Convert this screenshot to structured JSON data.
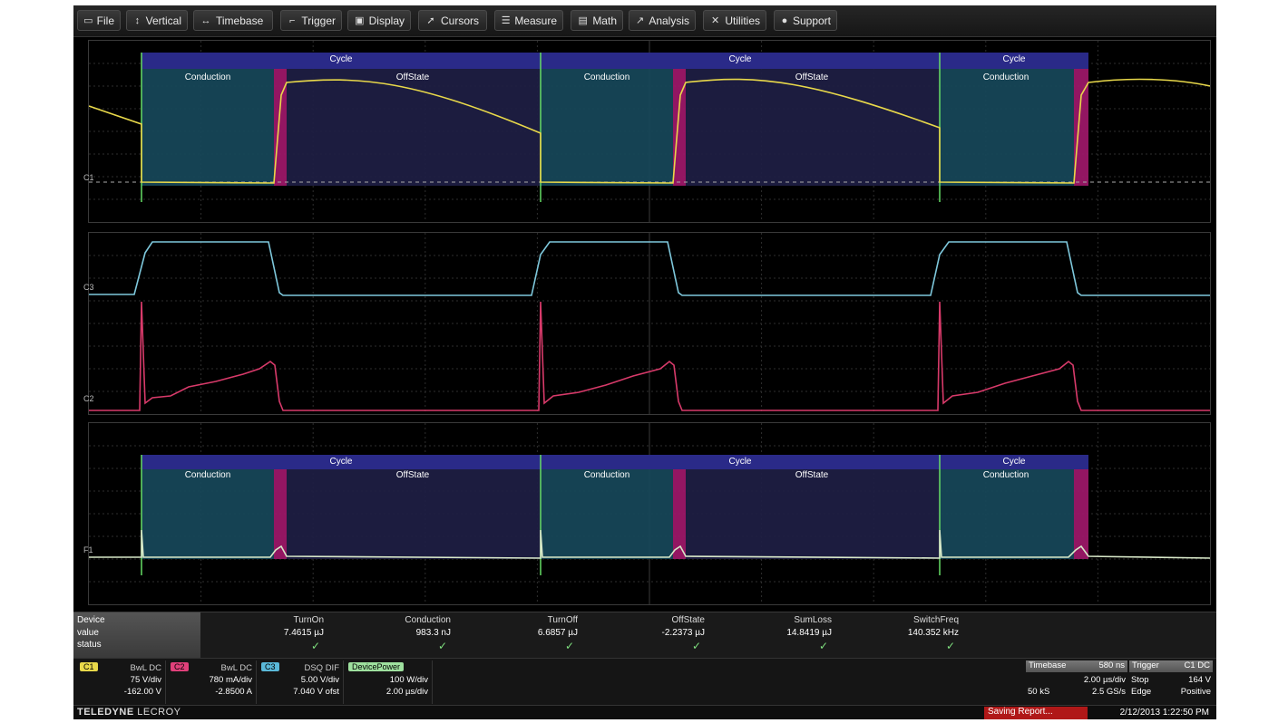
{
  "menu": [
    {
      "label": "File",
      "icon": "file-icon"
    },
    {
      "label": "Vertical",
      "icon": "vertical-icon"
    },
    {
      "label": "Timebase",
      "icon": "timebase-icon"
    },
    {
      "label": "Trigger",
      "icon": "trigger-icon"
    },
    {
      "label": "Display",
      "icon": "display-icon"
    },
    {
      "label": "Cursors",
      "icon": "cursors-icon"
    },
    {
      "label": "Measure",
      "icon": "measure-icon"
    },
    {
      "label": "Math",
      "icon": "math-icon"
    },
    {
      "label": "Analysis",
      "icon": "analysis-icon"
    },
    {
      "label": "Utilities",
      "icon": "utilities-icon"
    },
    {
      "label": "Support",
      "icon": "support-icon"
    }
  ],
  "zones": {
    "cycle_label": "Cycle",
    "conduction_label": "Conduction",
    "offstate_label": "OffState"
  },
  "channel_markers": {
    "c1": "C1",
    "c2": "C2",
    "c3": "C3",
    "f1": "F1"
  },
  "measurements": {
    "row_labels": {
      "device": "Device",
      "value": "value",
      "status": "status"
    },
    "columns": [
      {
        "header": "TurnOn",
        "value": "7.4615 µJ",
        "status": "✓"
      },
      {
        "header": "Conduction",
        "value": "983.3 nJ",
        "status": "✓"
      },
      {
        "header": "TurnOff",
        "value": "6.6857 µJ",
        "status": "✓"
      },
      {
        "header": "OffState",
        "value": "-2.2373 µJ",
        "status": "✓"
      },
      {
        "header": "SumLoss",
        "value": "14.8419 µJ",
        "status": "✓"
      },
      {
        "header": "SwitchFreq",
        "value": "140.352 kHz",
        "status": "✓"
      }
    ]
  },
  "channels": [
    {
      "tag": "C1",
      "color": "#e8d84a",
      "coupling": "BwL DC",
      "scale": "75 V/div",
      "offset": "-162.00 V"
    },
    {
      "tag": "C2",
      "color": "#e0407a",
      "coupling": "BwL DC",
      "scale": "780 mA/div",
      "offset": "-2.8500 A"
    },
    {
      "tag": "C3",
      "color": "#5ab8d8",
      "coupling": "DSQ DIF",
      "scale": "5.00 V/div",
      "offset": "7.040 V ofst"
    },
    {
      "tag": "DevicePower",
      "color": "#9ee09e",
      "coupling": "",
      "scale": "100 W/div",
      "offset": "2.00 µs/div"
    }
  ],
  "timebase": {
    "label": "Timebase",
    "delay": "580 ns",
    "scale": "2.00 µs/div",
    "samples": "50 kS",
    "rate": "2.5 GS/s"
  },
  "trigger": {
    "label": "Trigger",
    "source": "C1 DC",
    "mode": "Stop",
    "level": "164 V",
    "type": "Edge",
    "slope": "Positive"
  },
  "status": {
    "brand_bold": "TELEDYNE",
    "brand_rest": "LECROY",
    "saving": "Saving Report...",
    "datetime": "2/12/2013 1:22:50 PM"
  },
  "colors": {
    "cycle_bar": "#2a2a88",
    "conduction_zone": "#17485a",
    "transition_zone": "#a0186a",
    "offstate_zone": "#1e1e44",
    "c1_trace": "#e8d84a",
    "c2_trace": "#d83a6a",
    "c3_trace": "#7ec8dc",
    "power_trace": "#d8e8c8",
    "edge_marker": "#66dd66"
  }
}
